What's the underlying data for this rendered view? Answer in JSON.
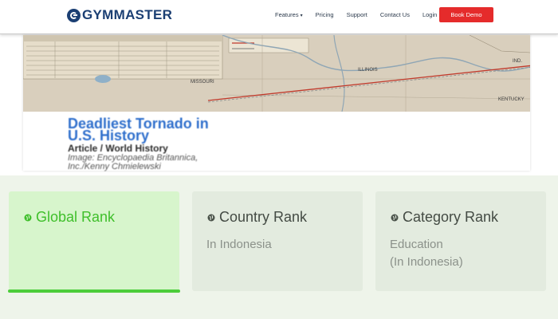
{
  "brand": {
    "name": "GYMMASTER"
  },
  "nav": {
    "items": [
      {
        "label": "Features",
        "has_caret": true
      },
      {
        "label": "Pricing"
      },
      {
        "label": "Support"
      },
      {
        "label": "Contact Us"
      },
      {
        "label": "Login"
      }
    ],
    "cta": "Book Demo"
  },
  "hero": {
    "title_line1": "Deadliest Tornado in",
    "title_line2": "U.S. History",
    "subtitle": "Article / World History",
    "credit_line1": "Image: Encyclopaedia Britannica,",
    "credit_line2": "Inc./Kenny Chmielewski",
    "map_labels": [
      "MISSOURI",
      "ILLINOIS",
      "IND.",
      "KENTUCKY"
    ]
  },
  "ranks": [
    {
      "title": "Global Rank",
      "sub1": "",
      "sub2": "",
      "active": true
    },
    {
      "title": "Country Rank",
      "sub1": "In Indonesia",
      "sub2": "",
      "active": false
    },
    {
      "title": "Category Rank",
      "sub1": "Education",
      "sub2": "(In Indonesia)",
      "active": false
    }
  ],
  "colors": {
    "brand": "#1b3f73",
    "cta": "#e52b2b",
    "active_green": "#3fbf2b",
    "card_bg": "#e3ebdf",
    "card_active_bg": "#d7f5cc",
    "hero_title": "#2f6fcc"
  }
}
